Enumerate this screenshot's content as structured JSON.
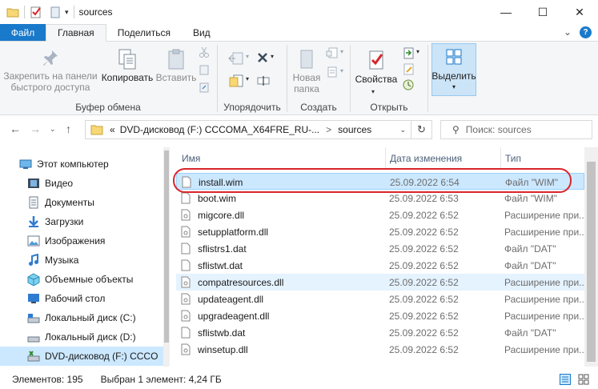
{
  "window": {
    "title": "sources",
    "controls": {
      "minimize": "—",
      "maximize": "☐",
      "close": "✕"
    }
  },
  "ribbon_tabs": [
    "Файл",
    "Главная",
    "Поделиться",
    "Вид"
  ],
  "ribbon": {
    "clipboard": {
      "pin_label": "Закрепить на панели быстрого доступа",
      "pin_line1": "Закрепить на панели",
      "pin_line2": "быстрого доступа",
      "copy_label": "Копировать",
      "paste_label": "Вставить",
      "group_label": "Буфер обмена"
    },
    "organize": {
      "group_label": "Упорядочить"
    },
    "create": {
      "new_folder_line1": "Новая",
      "new_folder_line2": "папка",
      "group_label": "Создать"
    },
    "open": {
      "properties_label": "Свойства",
      "group_label": "Открыть"
    },
    "select": {
      "select_label": "Выделить"
    }
  },
  "address": {
    "path_prefix": "«",
    "path_segment_1": "DVD-дисковод (F:) CCCOMA_X64FRE_RU-...",
    "path_separator": ">",
    "path_segment_2": "sources",
    "search_placeholder": "Поиск: sources"
  },
  "nav_pane": {
    "items": [
      {
        "label": "Этот компьютер",
        "icon": "computer-icon"
      },
      {
        "label": "Видео",
        "icon": "video-icon"
      },
      {
        "label": "Документы",
        "icon": "documents-icon"
      },
      {
        "label": "Загрузки",
        "icon": "downloads-icon"
      },
      {
        "label": "Изображения",
        "icon": "pictures-icon"
      },
      {
        "label": "Музыка",
        "icon": "music-icon"
      },
      {
        "label": "Объемные объекты",
        "icon": "3d-objects-icon"
      },
      {
        "label": "Рабочий стол",
        "icon": "desktop-icon"
      },
      {
        "label": "Локальный диск (C:)",
        "icon": "drive-icon"
      },
      {
        "label": "Локальный диск (D:)",
        "icon": "drive-icon"
      },
      {
        "label": "DVD-дисковод (F:) CCCO",
        "icon": "dvd-drive-icon"
      }
    ]
  },
  "file_list": {
    "columns": [
      "Имя",
      "Дата изменения",
      "Тип"
    ],
    "rows": [
      {
        "name": "install.wim",
        "date": "25.09.2022 6:54",
        "type": "Файл \"WIM\""
      },
      {
        "name": "boot.wim",
        "date": "25.09.2022 6:53",
        "type": "Файл \"WIM\""
      },
      {
        "name": "migcore.dll",
        "date": "25.09.2022 6:52",
        "type": "Расширение при..."
      },
      {
        "name": "setupplatform.dll",
        "date": "25.09.2022 6:52",
        "type": "Расширение при..."
      },
      {
        "name": "sflistrs1.dat",
        "date": "25.09.2022 6:52",
        "type": "Файл \"DAT\""
      },
      {
        "name": "sflistwt.dat",
        "date": "25.09.2022 6:52",
        "type": "Файл \"DAT\""
      },
      {
        "name": "compatresources.dll",
        "date": "25.09.2022 6:52",
        "type": "Расширение при..."
      },
      {
        "name": "updateagent.dll",
        "date": "25.09.2022 6:52",
        "type": "Расширение при..."
      },
      {
        "name": "upgradeagent.dll",
        "date": "25.09.2022 6:52",
        "type": "Расширение при..."
      },
      {
        "name": "sflistwb.dat",
        "date": "25.09.2022 6:52",
        "type": "Файл \"DAT\""
      },
      {
        "name": "winsetup.dll",
        "date": "25.09.2022 6:52",
        "type": "Расширение при..."
      }
    ]
  },
  "status_bar": {
    "items_count": "Элементов: 195",
    "selection": "Выбран 1 элемент: 4,24 ГБ"
  },
  "colors": {
    "accent": "#1979ca",
    "selection": "#cce8ff",
    "highlight_oval": "#d9252b",
    "folder": "#f8d775"
  }
}
